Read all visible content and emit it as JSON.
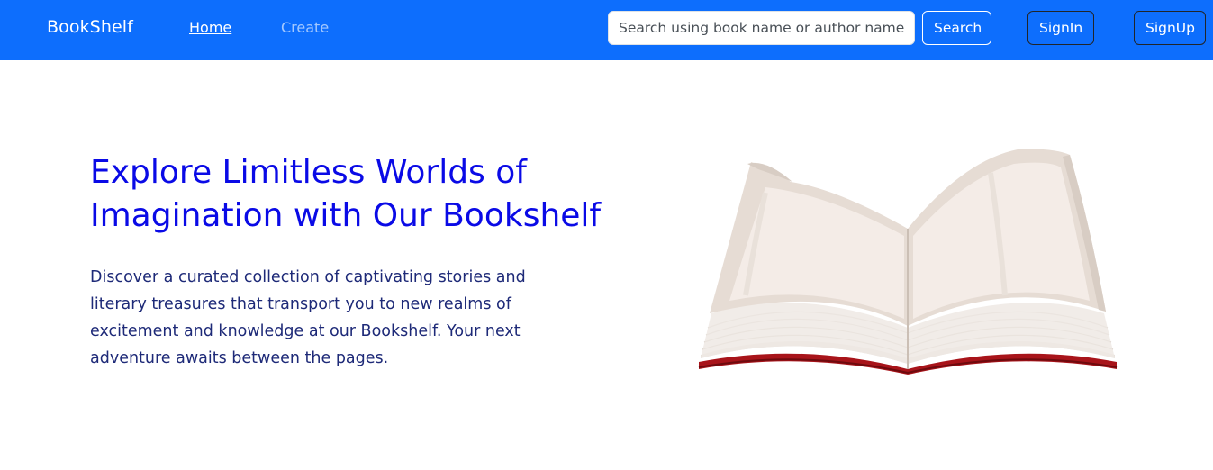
{
  "navbar": {
    "brand": "BookShelf",
    "links": [
      {
        "label": "Home",
        "active": true
      },
      {
        "label": "Create",
        "active": false
      }
    ],
    "search": {
      "placeholder": "Search using book name or author name",
      "value": "",
      "button_label": "Search"
    },
    "signin_label": "SignIn",
    "signup_label": "SignUp"
  },
  "hero": {
    "title": "Explore Limitless Worlds of Imagination with Our Bookshelf",
    "description": "Discover a curated collection of captivating stories and literary treasures that transport you to new realms of excitement and knowledge at our Bookshelf. Your next adventure awaits between the pages.",
    "image_icon": "open-book-icon"
  },
  "colors": {
    "navbar_bg": "#0d6efd",
    "title": "#0a0ae6",
    "body_text": "#1e2a78",
    "book_cover": "#a8141a"
  }
}
